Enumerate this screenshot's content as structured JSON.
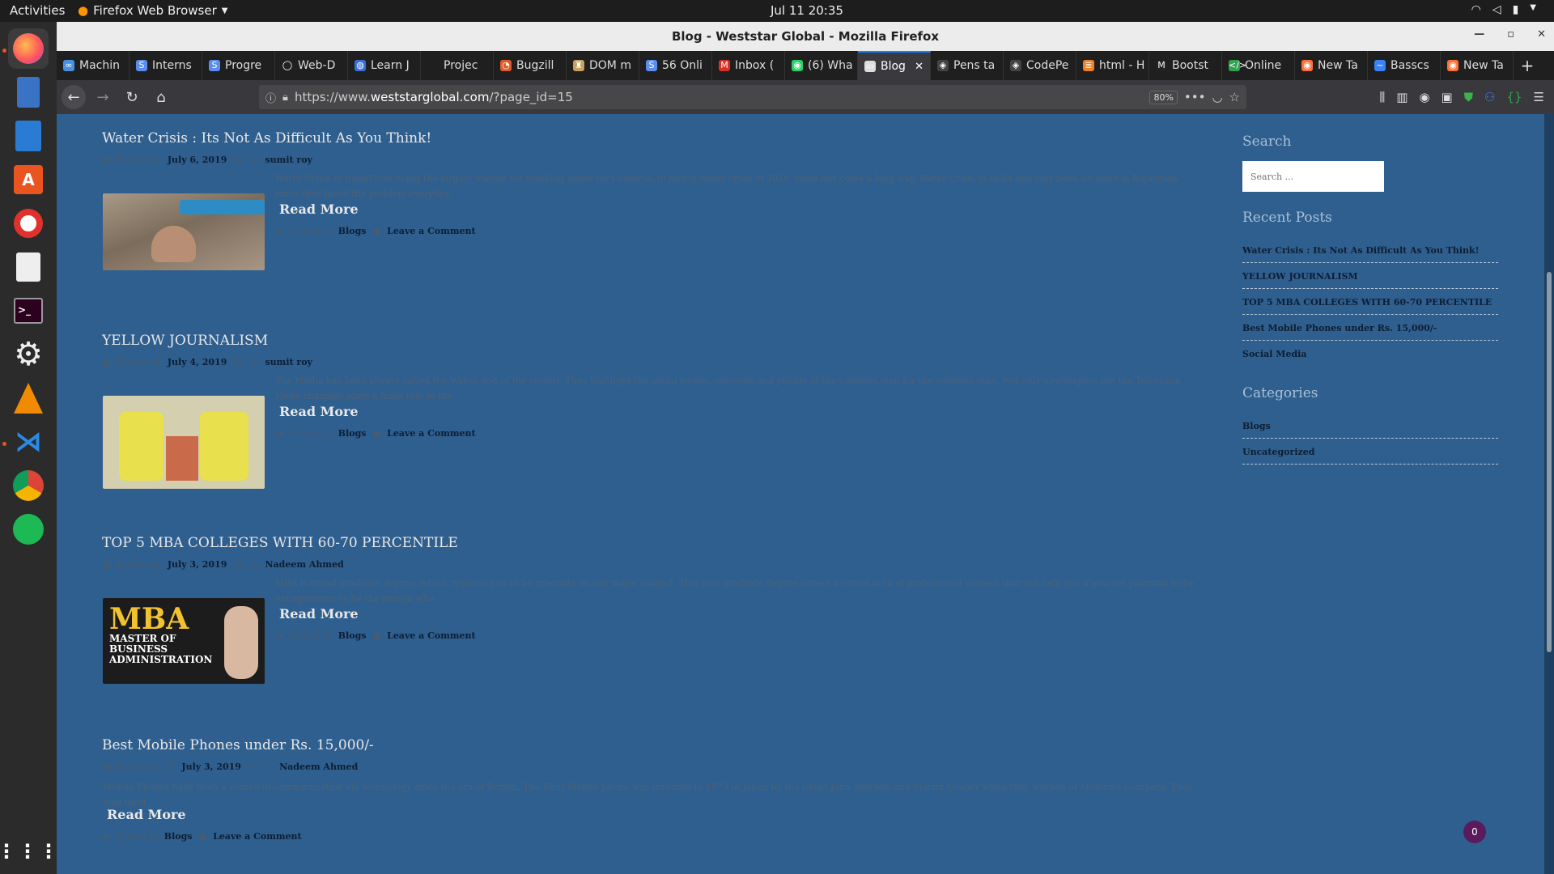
{
  "topbar": {
    "activities": "Activities",
    "app_name": "Firefox Web Browser",
    "clock": "Jul 11  20:35"
  },
  "window": {
    "title": "Blog - Weststar Global - Mozilla Firefox"
  },
  "tabs": [
    {
      "label": "Machin",
      "icon": "∞",
      "color": "#4a90e2"
    },
    {
      "label": "Interns",
      "icon": "S",
      "color": "#5b8def"
    },
    {
      "label": "Progre",
      "icon": "S",
      "color": "#5b8def"
    },
    {
      "label": "Web-D",
      "icon": "◯",
      "color": "#222"
    },
    {
      "label": "Learn J",
      "icon": "◍",
      "color": "#3a6fd8"
    },
    {
      "label": "Projec",
      "icon": "",
      "color": "#1f1f1f"
    },
    {
      "label": "Bugzill",
      "icon": "◔",
      "color": "#e05a2a"
    },
    {
      "label": "DOM m",
      "icon": "♜",
      "color": "#c8a060"
    },
    {
      "label": "56 Onli",
      "icon": "S",
      "color": "#5b8def"
    },
    {
      "label": "Inbox (",
      "icon": "M",
      "color": "#d93025"
    },
    {
      "label": "(6) Wha",
      "icon": "◉",
      "color": "#25d366"
    },
    {
      "label": "Blog",
      "icon": "▭",
      "color": "#ddd",
      "active": true
    },
    {
      "label": "Pens ta",
      "icon": "◈",
      "color": "#444"
    },
    {
      "label": "CodePe",
      "icon": "◈",
      "color": "#444"
    },
    {
      "label": "html - H",
      "icon": "≣",
      "color": "#f48024"
    },
    {
      "label": "Bootst",
      "icon": "M",
      "color": "#222"
    },
    {
      "label": "Online",
      "icon": "</>",
      "color": "#2ea44f"
    },
    {
      "label": "New Ta",
      "icon": "◉",
      "color": "#ff7139"
    },
    {
      "label": "Basscs",
      "icon": "~",
      "color": "#3b82f6"
    },
    {
      "label": "New Ta",
      "icon": "◉",
      "color": "#ff7139"
    }
  ],
  "nav": {
    "url_prefix": "https://www.",
    "url_host": "weststarglobal.com",
    "url_path": "/?page_id=15",
    "zoom": "80%"
  },
  "posts": [
    {
      "title": "Water Crisis : Its Not As Difficult As You Think!",
      "posted_on": "Posted on",
      "date": "July 6, 2019",
      "by": "by",
      "author": "sumit roy",
      "excerpt": "Water Crisis in IndiaFrom being the largest market for drinking water for Cemeros, to facing water crisis in 2019, India has come a long way. Water Crisis in India had only been an issue in Rajasthan, since they faced the problem everyday.",
      "read_more": "Read More",
      "posted_in": "Posted in",
      "category": "Blogs",
      "comment": "Leave a Comment"
    },
    {
      "title": "YELLOW JOURNALISM",
      "posted_on": "Posted on",
      "date": "July 4, 2019",
      "by": "by",
      "author": "sumit roy",
      "excerpt": "The Media has been always called the Watch dog of the society. They highlight the social issues, concerns and plights of the common man for the common man. Not only newspapers but the Television News channels plays a huge role in the",
      "read_more": "Read More",
      "posted_in": "Posted in",
      "category": "Blogs",
      "comment": "Leave a Comment"
    },
    {
      "title": "TOP 5 MBA COLLEGES WITH 60-70 PERCENTILE",
      "posted_on": "Posted on",
      "date": "July 3, 2019",
      "by": "by",
      "author": "Nadeem Ahmed",
      "excerpt": "MBA is broad graduate degree, which requires you to be graduate on any major subject. This post graduate degree covers a varied area of professional careers that will help you if you are planning to be entrepreneur or be the person who",
      "read_more": "Read More",
      "posted_in": "Posted in",
      "category": "Blogs",
      "comment": "Leave a Comment",
      "thumb_text": [
        "MBA",
        "MASTER OF",
        "BUSINESS",
        "ADMINISTRATION"
      ]
    },
    {
      "title": "Best Mobile Phones under Rs. 15,000/-",
      "posted_on": "Posted on",
      "date": "July 3, 2019",
      "by": "by",
      "author": "Nadeem Ahmed",
      "excerpt": "Mobile Phones have been a source of communication via technology since the era of British. The First Mobile phone was invented in 1973 in Japan by the Great John Mitchell and Martin Cooper when they worked at Motorola Company. They only used",
      "read_more": "Read More",
      "posted_in": "Posted in",
      "category": "Blogs",
      "comment": "Leave a Comment"
    }
  ],
  "sidebar": {
    "search_heading": "Search",
    "search_placeholder": "Search ...",
    "recent_heading": "Recent Posts",
    "recent": [
      "Water Crisis : Its Not As Difficult As You Think!",
      "YELLOW JOURNALISM",
      "TOP 5 MBA COLLEGES WITH 60-70 PERCENTILE",
      "Best Mobile Phones under Rs. 15,000/-",
      "Social Media"
    ],
    "categories_heading": "Categories",
    "categories": [
      "Blogs",
      "Uncategorized"
    ]
  },
  "chat_count": "0"
}
